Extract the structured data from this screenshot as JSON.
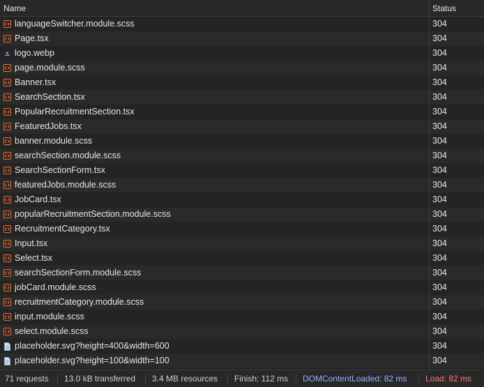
{
  "columns": {
    "name": "Name",
    "status": "Status"
  },
  "rows": [
    {
      "name": "languageSwitcher.module.scss",
      "status": "304",
      "icon": "code-file-icon"
    },
    {
      "name": "Page.tsx",
      "status": "304",
      "icon": "code-file-icon"
    },
    {
      "name": "logo.webp",
      "status": "304",
      "icon": "image-file-icon"
    },
    {
      "name": "page.module.scss",
      "status": "304",
      "icon": "code-file-icon"
    },
    {
      "name": "Banner.tsx",
      "status": "304",
      "icon": "code-file-icon"
    },
    {
      "name": "SearchSection.tsx",
      "status": "304",
      "icon": "code-file-icon"
    },
    {
      "name": "PopularRecruitmentSection.tsx",
      "status": "304",
      "icon": "code-file-icon"
    },
    {
      "name": "FeaturedJobs.tsx",
      "status": "304",
      "icon": "code-file-icon"
    },
    {
      "name": "banner.module.scss",
      "status": "304",
      "icon": "code-file-icon"
    },
    {
      "name": "searchSection.module.scss",
      "status": "304",
      "icon": "code-file-icon"
    },
    {
      "name": "SearchSectionForm.tsx",
      "status": "304",
      "icon": "code-file-icon"
    },
    {
      "name": "featuredJobs.module.scss",
      "status": "304",
      "icon": "code-file-icon"
    },
    {
      "name": "JobCard.tsx",
      "status": "304",
      "icon": "code-file-icon"
    },
    {
      "name": "popularRecruitmentSection.module.scss",
      "status": "304",
      "icon": "code-file-icon"
    },
    {
      "name": "RecruitmentCategory.tsx",
      "status": "304",
      "icon": "code-file-icon"
    },
    {
      "name": "Input.tsx",
      "status": "304",
      "icon": "code-file-icon"
    },
    {
      "name": "Select.tsx",
      "status": "304",
      "icon": "code-file-icon"
    },
    {
      "name": "searchSectionForm.module.scss",
      "status": "304",
      "icon": "code-file-icon"
    },
    {
      "name": "jobCard.module.scss",
      "status": "304",
      "icon": "code-file-icon"
    },
    {
      "name": "recruitmentCategory.module.scss",
      "status": "304",
      "icon": "code-file-icon"
    },
    {
      "name": "input.module.scss",
      "status": "304",
      "icon": "code-file-icon"
    },
    {
      "name": "select.module.scss",
      "status": "304",
      "icon": "code-file-icon"
    },
    {
      "name": "placeholder.svg?height=400&width=600",
      "status": "304",
      "icon": "document-file-icon"
    },
    {
      "name": "placeholder.svg?height=100&width=100",
      "status": "304",
      "icon": "document-file-icon"
    }
  ],
  "summary": {
    "requests": "71 requests",
    "transferred": "13.0 kB transferred",
    "resources": "3.4 MB resources",
    "finish": "Finish: 112 ms",
    "dom_content_loaded": "DOMContentLoaded: 82 ms",
    "load": "Load: 82 ms"
  },
  "colors": {
    "background": "#242424",
    "code_icon": "#e8773a",
    "dom_content_loaded": "#8fb4ff",
    "load": "#ff7b72"
  }
}
